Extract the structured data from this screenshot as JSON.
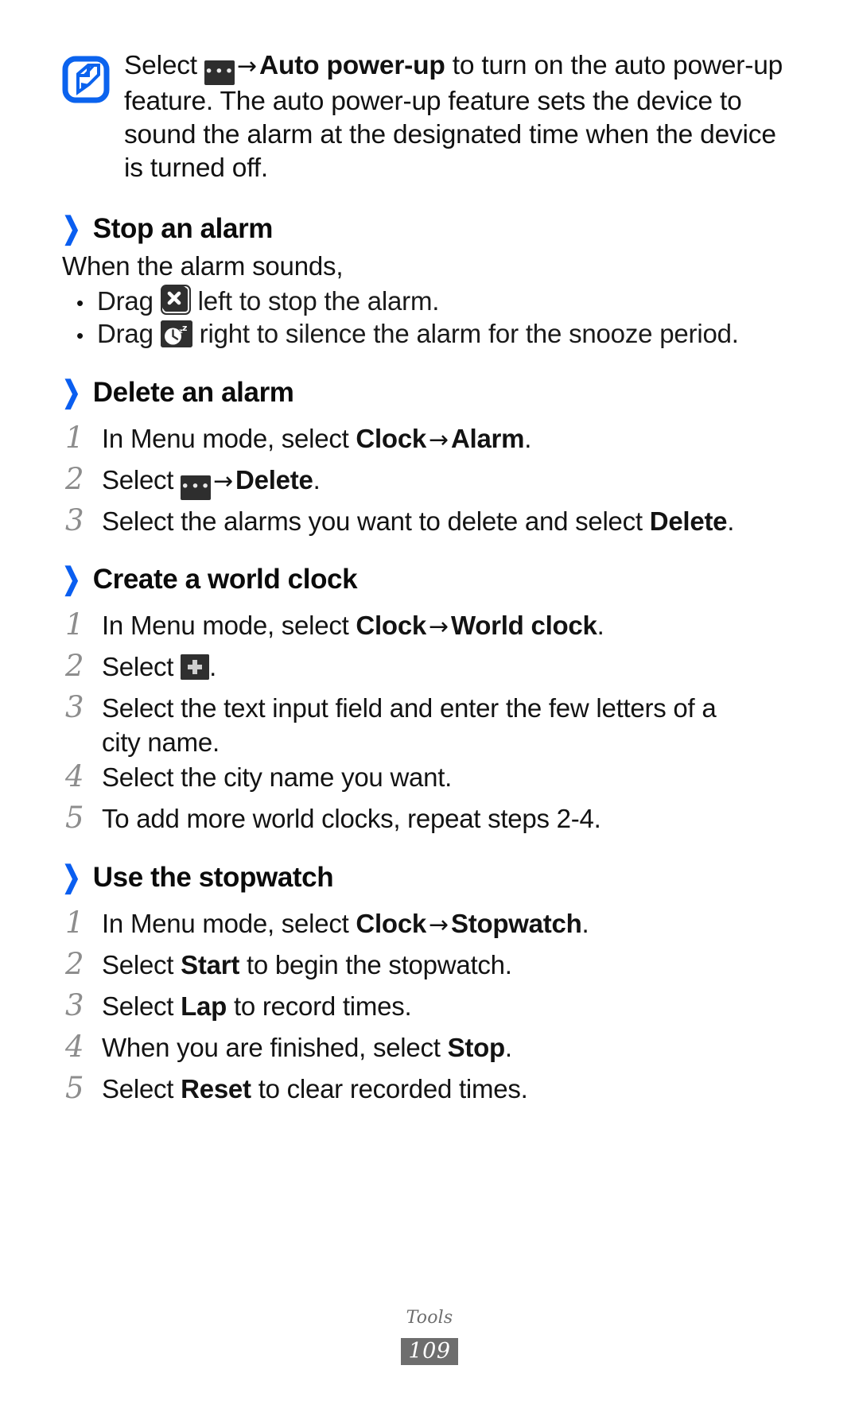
{
  "document": {
    "footer_section": "Tools",
    "page_number": "109",
    "accent_color": "#0a5ef0",
    "note_icon_color": "#0b63ee",
    "key_icon_color": "#2f2f2f"
  },
  "note": {
    "icon": "note-pencil-icon",
    "line1_prefix": "Select ",
    "arrow": "→",
    "bold1": "Auto power-up",
    "rest": " to turn on the auto power-up feature. The auto power-up feature sets the device to sound the alarm at the designated time when the device is turned off."
  },
  "sections": [
    {
      "id": "stop-an-alarm",
      "chevron": "❯",
      "title": "Stop an alarm",
      "intro": "When the alarm sounds,",
      "bullets": [
        {
          "id": "bullet-stop",
          "dot": "•",
          "prefix": "Drag ",
          "icon": "stop-x-icon",
          "suffix": " left to stop the alarm."
        },
        {
          "id": "bullet-snooze",
          "dot": "•",
          "prefix": "Drag ",
          "icon": "snooze-clock-icon",
          "suffix": " right to silence the alarm for the snooze period."
        }
      ]
    },
    {
      "id": "delete-an-alarm",
      "chevron": "❯",
      "title": "Delete an alarm",
      "steps": [
        {
          "num": "1",
          "parts": [
            {
              "t": "text",
              "v": "In Menu mode, select "
            },
            {
              "t": "bold",
              "v": "Clock"
            },
            {
              "t": "arrow",
              "v": "→"
            },
            {
              "t": "bold",
              "v": "Alarm"
            },
            {
              "t": "text",
              "v": "."
            }
          ]
        },
        {
          "num": "2",
          "parts": [
            {
              "t": "text",
              "v": "Select "
            },
            {
              "t": "icon",
              "v": "more-options-icon"
            },
            {
              "t": "arrow",
              "v": "→"
            },
            {
              "t": "bold",
              "v": "Delete"
            },
            {
              "t": "text",
              "v": "."
            }
          ]
        },
        {
          "num": "3",
          "parts": [
            {
              "t": "text",
              "v": "Select the alarms you want to delete and select "
            },
            {
              "t": "bold",
              "v": "Delete"
            },
            {
              "t": "text",
              "v": "."
            }
          ]
        }
      ]
    },
    {
      "id": "create-a-world-clock",
      "chevron": "❯",
      "title": "Create a world clock",
      "steps": [
        {
          "num": "1",
          "parts": [
            {
              "t": "text",
              "v": "In Menu mode, select "
            },
            {
              "t": "bold",
              "v": "Clock"
            },
            {
              "t": "arrow",
              "v": "→"
            },
            {
              "t": "bold",
              "v": "World clock"
            },
            {
              "t": "text",
              "v": "."
            }
          ]
        },
        {
          "num": "2",
          "parts": [
            {
              "t": "text",
              "v": "Select "
            },
            {
              "t": "icon",
              "v": "add-plus-icon"
            },
            {
              "t": "text",
              "v": "."
            }
          ]
        },
        {
          "num": "3",
          "parts": [
            {
              "t": "text",
              "v": "Select the text input field and enter the few letters of a city name."
            }
          ]
        },
        {
          "num": "4",
          "parts": [
            {
              "t": "text",
              "v": "Select the city name you want."
            }
          ]
        },
        {
          "num": "5",
          "parts": [
            {
              "t": "text",
              "v": "To add more world clocks, repeat steps 2-4."
            }
          ]
        }
      ]
    },
    {
      "id": "use-the-stopwatch",
      "chevron": "❯",
      "title": "Use the stopwatch",
      "steps": [
        {
          "num": "1",
          "parts": [
            {
              "t": "text",
              "v": "In Menu mode, select "
            },
            {
              "t": "bold",
              "v": "Clock"
            },
            {
              "t": "arrow",
              "v": "→"
            },
            {
              "t": "bold",
              "v": "Stopwatch"
            },
            {
              "t": "text",
              "v": "."
            }
          ]
        },
        {
          "num": "2",
          "parts": [
            {
              "t": "text",
              "v": "Select "
            },
            {
              "t": "bold",
              "v": "Start"
            },
            {
              "t": "text",
              "v": " to begin the stopwatch."
            }
          ]
        },
        {
          "num": "3",
          "parts": [
            {
              "t": "text",
              "v": "Select "
            },
            {
              "t": "bold",
              "v": "Lap"
            },
            {
              "t": "text",
              "v": " to record times."
            }
          ]
        },
        {
          "num": "4",
          "parts": [
            {
              "t": "text",
              "v": "When you are finished, select "
            },
            {
              "t": "bold",
              "v": "Stop"
            },
            {
              "t": "text",
              "v": "."
            }
          ]
        },
        {
          "num": "5",
          "parts": [
            {
              "t": "text",
              "v": "Select "
            },
            {
              "t": "bold",
              "v": "Reset"
            },
            {
              "t": "text",
              "v": " to clear recorded times."
            }
          ]
        }
      ]
    }
  ]
}
